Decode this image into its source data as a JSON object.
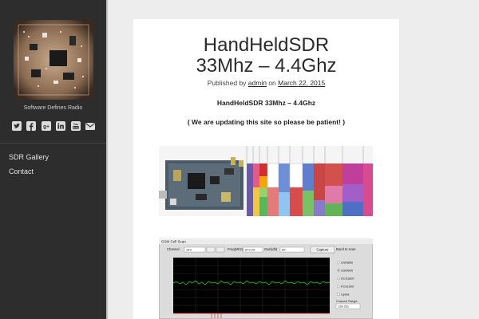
{
  "sidebar": {
    "tagline": "Software Defines Radio",
    "social_icons": [
      "twitter-icon",
      "facebook-icon",
      "google-plus-icon",
      "linkedin-icon",
      "youtube-icon",
      "email-icon"
    ],
    "nav": [
      {
        "label": "SDR Gallery"
      },
      {
        "label": "Contact"
      }
    ]
  },
  "post": {
    "title_line1": "HandHeldSDR",
    "title_line2": "33Mhz – 4.4Ghz",
    "meta_prefix": "Published by",
    "author": "admin",
    "meta_on": "on",
    "date": "March 22, 2015",
    "subheading": "HandHeldSDR 33Mhz – 4.4Ghz",
    "notice": "( We are updating this site so please be patient! )"
  },
  "images": {
    "spectrum_chart_title": "GSM Cell Scan",
    "spectrum_fields": {
      "channel_label": "Channel",
      "channel_value": "143",
      "freq_label": "Freq(Mhz)",
      "freq_value": "872.20",
      "gain_label": "Gain(db)",
      "gain_value": "50",
      "capture_label": "Capture",
      "band_label": "Band to scan",
      "bands": [
        "GSM850",
        "GSM900",
        "DCS1800",
        "PCS1900",
        "Uplink"
      ],
      "range_label": "Channel Range:",
      "range_value": "128-251"
    }
  },
  "colors": {
    "sidebar_bg": "#2d2d2d",
    "page_bg": "#ededed",
    "card_bg": "#ffffff",
    "plot_bg": "#000000",
    "trace": "#22dd22"
  }
}
